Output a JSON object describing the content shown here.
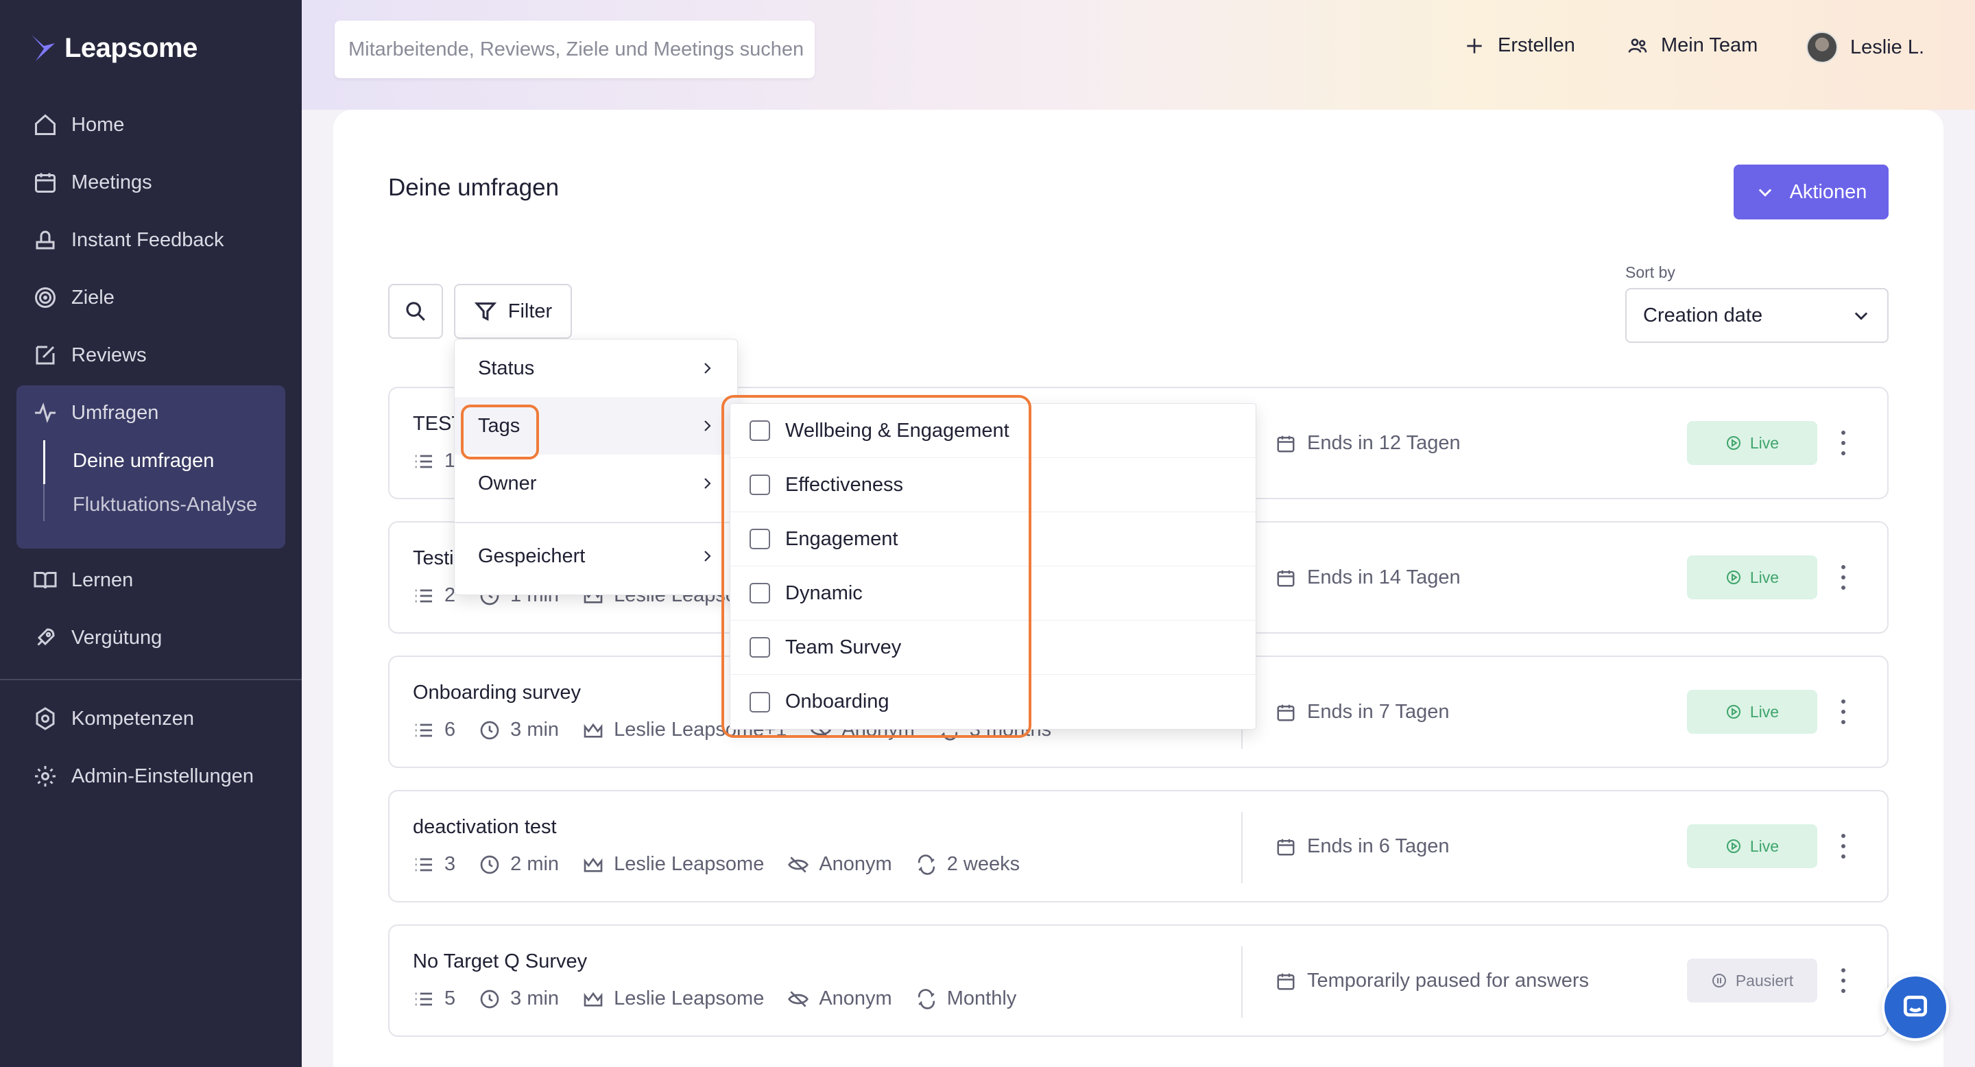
{
  "brand": {
    "name": "Leapsome"
  },
  "sidebar": {
    "items": [
      {
        "label": "Home",
        "icon": "home-icon"
      },
      {
        "label": "Meetings",
        "icon": "calendar-icon"
      },
      {
        "label": "Instant Feedback",
        "icon": "feedback-icon"
      },
      {
        "label": "Ziele",
        "icon": "target-icon"
      },
      {
        "label": "Reviews",
        "icon": "edit-icon"
      },
      {
        "label": "Umfragen",
        "icon": "pulse-icon"
      },
      {
        "label": "Lernen",
        "icon": "book-icon"
      },
      {
        "label": "Vergütung",
        "icon": "rocket-icon"
      },
      {
        "label": "Kompetenzen",
        "icon": "badge-icon"
      },
      {
        "label": "Admin-Einstellungen",
        "icon": "gear-icon"
      }
    ],
    "sub_items": [
      {
        "label": "Deine umfragen"
      },
      {
        "label": "Fluktuations-Analyse"
      }
    ]
  },
  "topbar": {
    "search_placeholder": "Mitarbeitende, Reviews, Ziele und Meetings suchen",
    "create_label": "Erstellen",
    "team_label": "Mein Team",
    "user_name": "Leslie L."
  },
  "page": {
    "title": "Deine umfragen",
    "actions_label": "Aktionen",
    "filter_label": "Filter",
    "sort_label": "Sort by",
    "sort_value": "Creation date"
  },
  "surveys": [
    {
      "title": "TEST",
      "questions": "1",
      "duration": "",
      "owner": "",
      "anonymity": "",
      "frequency": "",
      "ends": "Ends in 12 Tagen",
      "status": "Live"
    },
    {
      "title": "Testi",
      "questions": "2",
      "duration": "1 min",
      "owner": "Leslie Leapsome",
      "anonymity": "",
      "frequency": "",
      "ends": "Ends in 14 Tagen",
      "status": "Live"
    },
    {
      "title": "Onboarding survey",
      "questions": "6",
      "duration": "3 min",
      "owner": "Leslie Leapsome+1",
      "anonymity": "Anonym",
      "frequency": "3 months",
      "ends": "Ends in 7 Tagen",
      "status": "Live"
    },
    {
      "title": "deactivation test",
      "questions": "3",
      "duration": "2 min",
      "owner": "Leslie Leapsome",
      "anonymity": "Anonym",
      "frequency": "2 weeks",
      "ends": "Ends in 6 Tagen",
      "status": "Live"
    },
    {
      "title": "No Target Q Survey",
      "questions": "5",
      "duration": "3 min",
      "owner": "Leslie Leapsome",
      "anonymity": "Anonym",
      "frequency": "Monthly",
      "ends": "Temporarily paused for answers",
      "status": "Pausiert"
    }
  ],
  "filter_menu": {
    "items": [
      {
        "label": "Status"
      },
      {
        "label": "Tags"
      },
      {
        "label": "Owner"
      },
      {
        "label": "Gespeichert"
      }
    ]
  },
  "tags_submenu": {
    "options": [
      {
        "label": "Wellbeing & Engagement",
        "checked": false
      },
      {
        "label": "Effectiveness",
        "checked": false
      },
      {
        "label": "Engagement",
        "checked": false
      },
      {
        "label": "Dynamic",
        "checked": false
      },
      {
        "label": "Team Survey",
        "checked": false
      },
      {
        "label": "Onboarding",
        "checked": false
      }
    ]
  },
  "colors": {
    "sidebar_bg": "#27283e",
    "accent": "#6b63e8",
    "highlight_outline": "#f07c3a",
    "live_badge": "#dcf3e6",
    "paused_badge": "#ececf2"
  }
}
